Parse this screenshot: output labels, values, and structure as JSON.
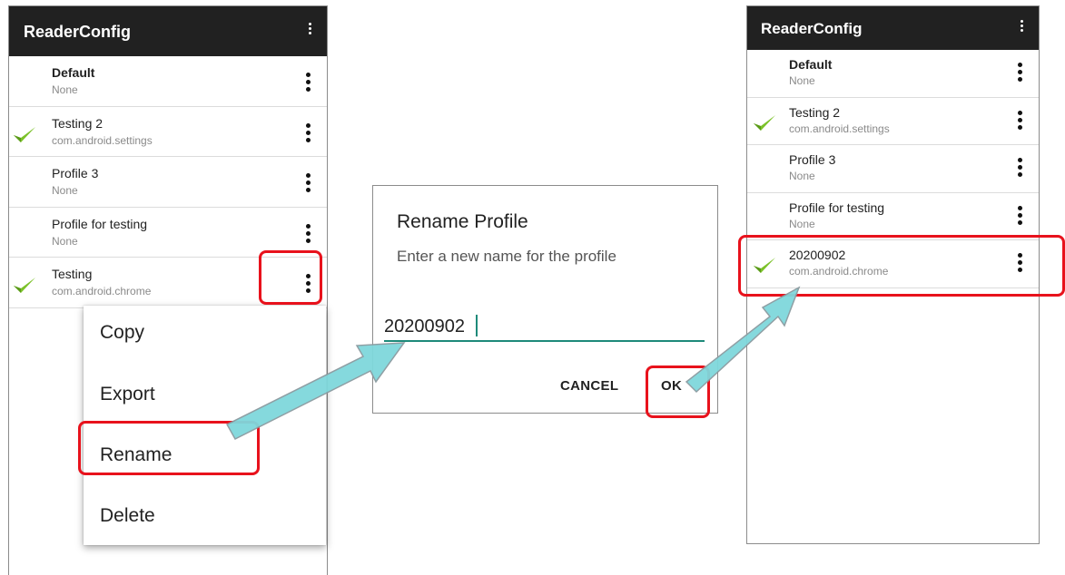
{
  "left_screen": {
    "app_title": "ReaderConfig",
    "profiles": [
      {
        "name": "Default",
        "package": "None",
        "active": false,
        "bold": true
      },
      {
        "name": "Testing 2",
        "package": "com.android.settings",
        "active": true,
        "bold": false
      },
      {
        "name": "Profile 3",
        "package": "None",
        "active": false,
        "bold": false
      },
      {
        "name": "Profile for testing",
        "package": "None",
        "active": false,
        "bold": false
      },
      {
        "name": "Testing",
        "package": "com.android.chrome",
        "active": true,
        "bold": false
      }
    ],
    "context_menu": [
      "Copy",
      "Export",
      "Rename",
      "Delete"
    ]
  },
  "rename_dialog": {
    "title": "Rename Profile",
    "message": "Enter a new name for the profile",
    "input_value": "20200902",
    "cancel_label": "CANCEL",
    "ok_label": "OK"
  },
  "right_screen": {
    "app_title": "ReaderConfig",
    "profiles": [
      {
        "name": "Default",
        "package": "None",
        "active": false,
        "bold": true
      },
      {
        "name": "Testing 2",
        "package": "com.android.settings",
        "active": true,
        "bold": false
      },
      {
        "name": "Profile 3",
        "package": "None",
        "active": false,
        "bold": false
      },
      {
        "name": "Profile for testing",
        "package": "None",
        "active": false,
        "bold": false
      },
      {
        "name": "20200902",
        "package": "com.android.chrome",
        "active": true,
        "bold": false
      }
    ]
  },
  "icons": {
    "check": "check-icon",
    "overflow": "overflow-menu-icon"
  },
  "colors": {
    "app_bar": "#212121",
    "highlight": "#e8121c",
    "arrow": "#7fd8dc",
    "check": "#7cc22a",
    "input_underline": "#1e8a7a"
  }
}
